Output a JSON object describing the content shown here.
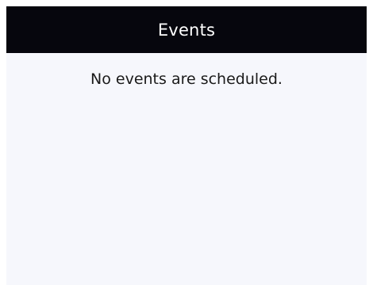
{
  "panel": {
    "title": "Events",
    "empty_message": "No events are scheduled."
  },
  "colors": {
    "header_background": "#06060d",
    "header_text": "#ffffff",
    "panel_background": "#f6f7fc",
    "body_text": "#1a1a1a"
  }
}
